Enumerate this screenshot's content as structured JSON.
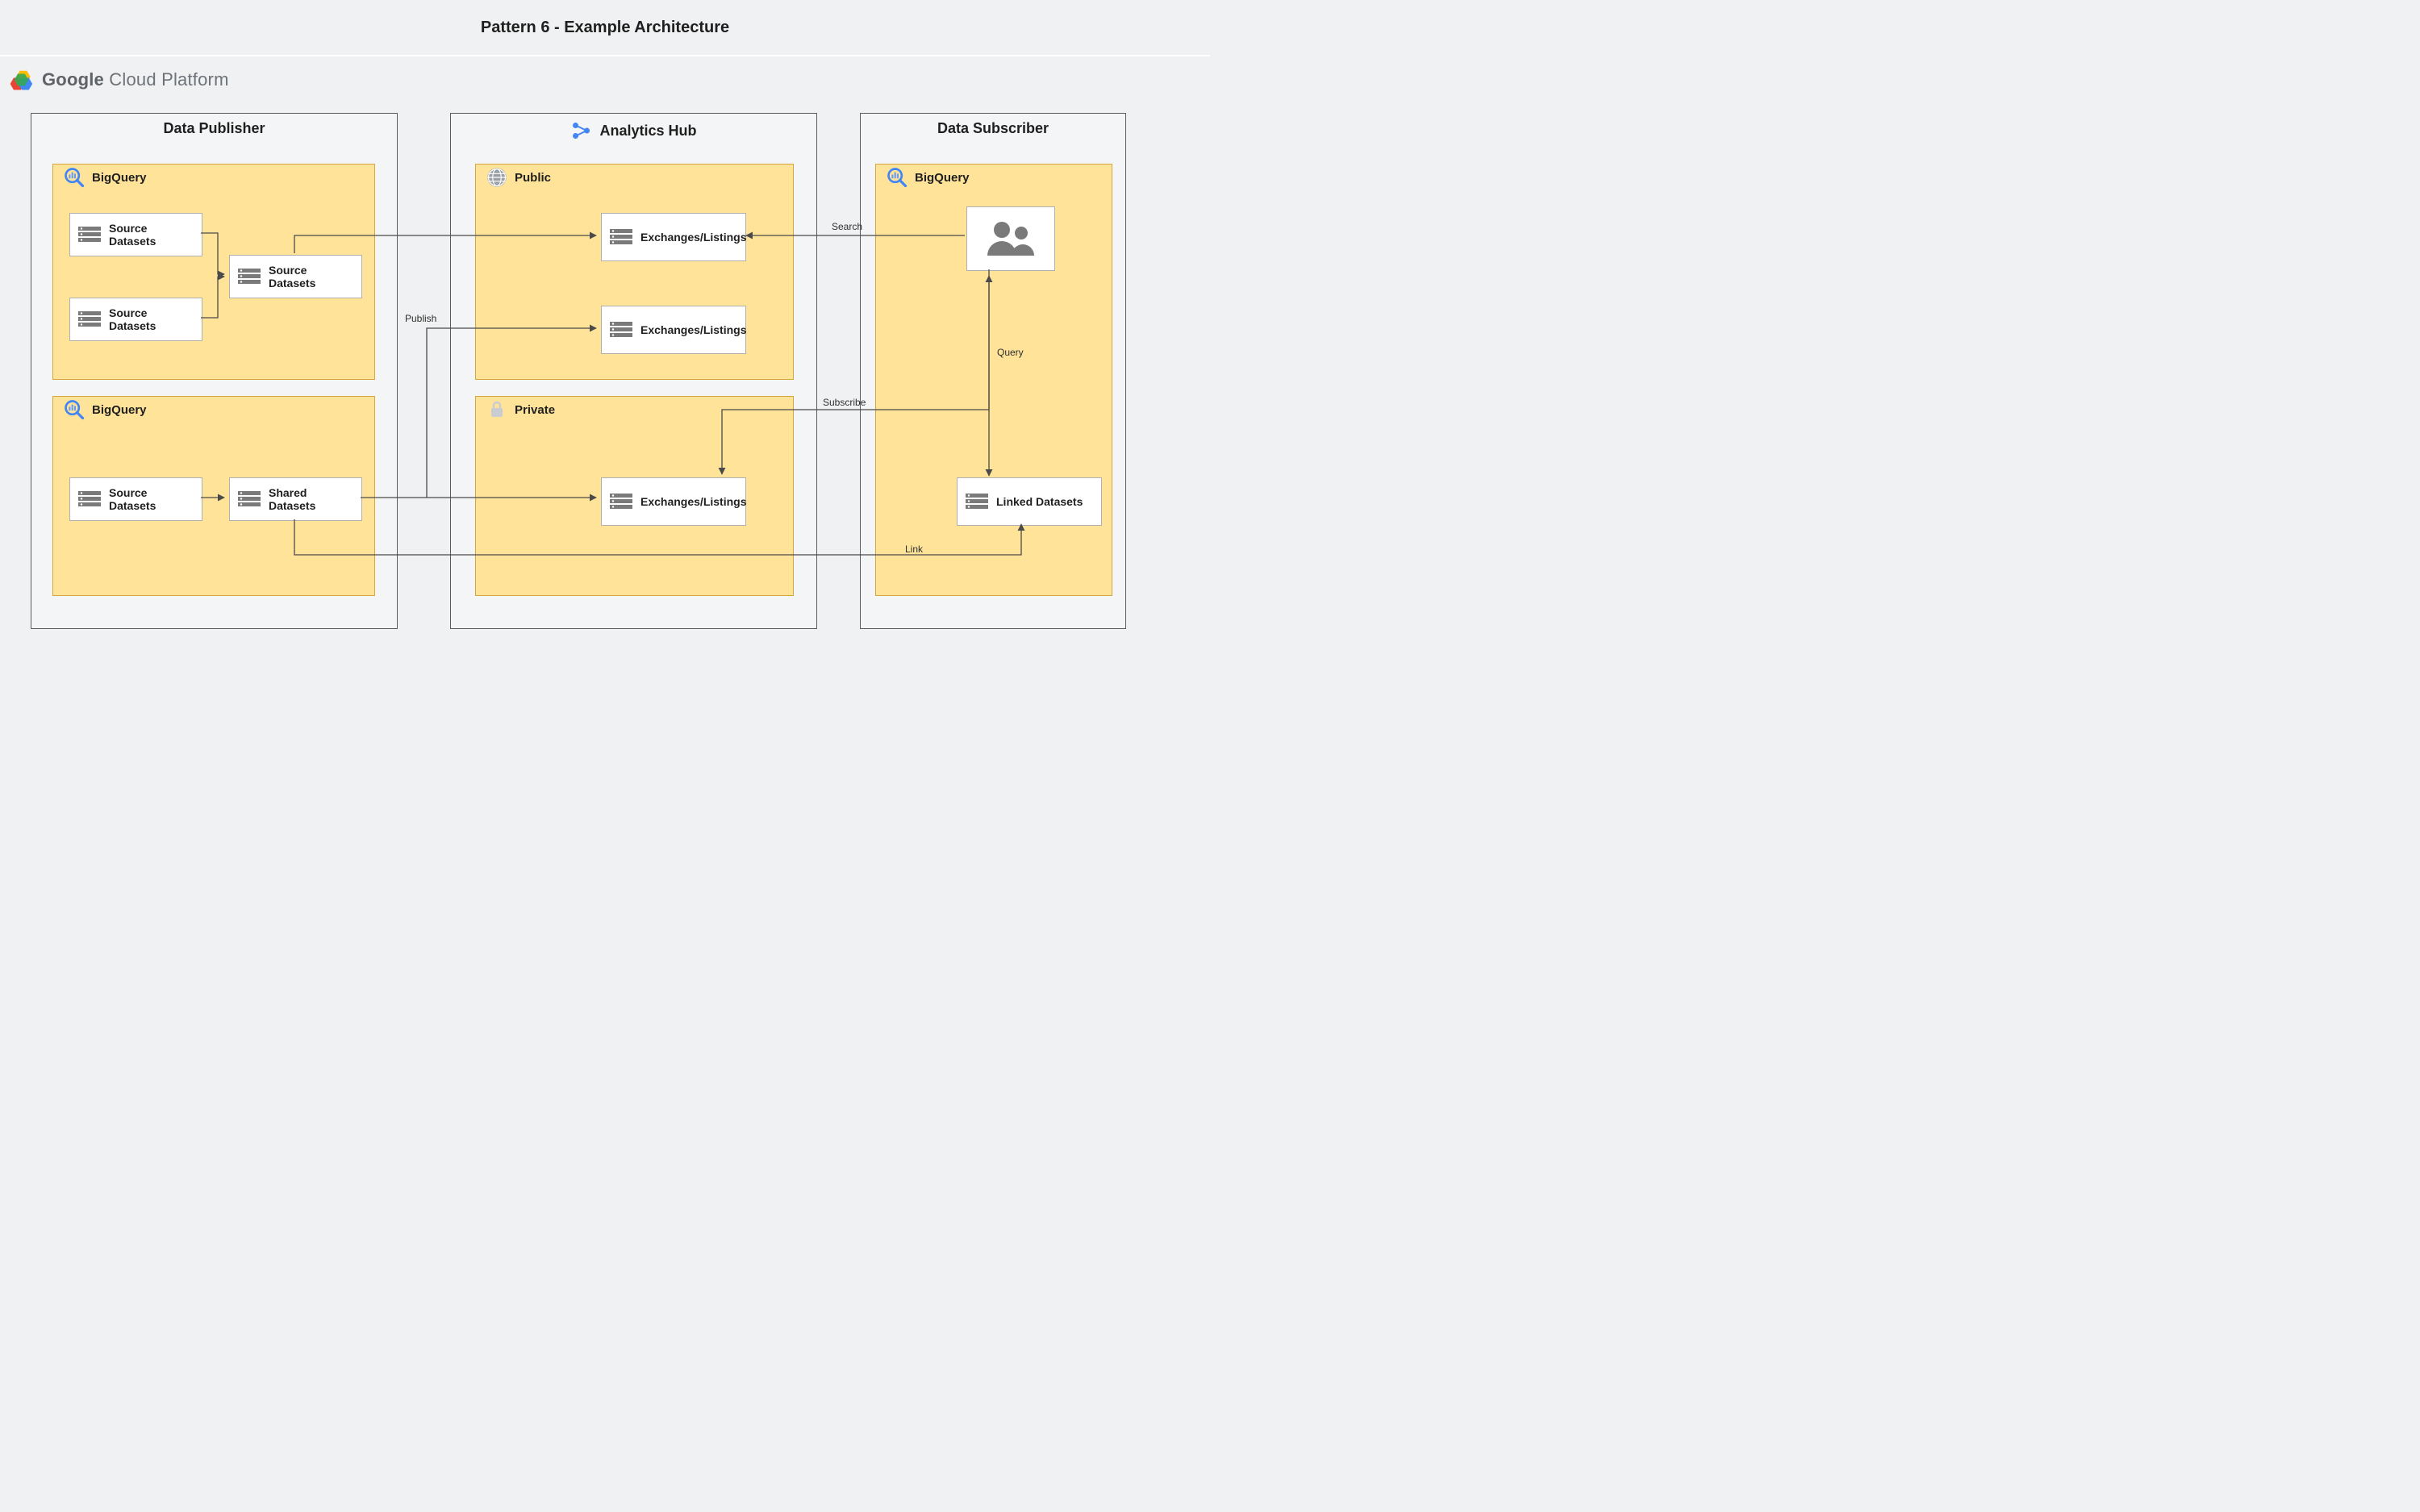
{
  "title": "Pattern 6 - Example Architecture",
  "platform_label_bold": "Google",
  "platform_label_light": " Cloud Platform",
  "columns": {
    "publisher": {
      "title": "Data Publisher"
    },
    "hub": {
      "title": "Analytics Hub"
    },
    "subscriber": {
      "title": "Data Subscriber"
    }
  },
  "publisher": {
    "bq1": {
      "label": "BigQuery",
      "src_a": "Source Datasets",
      "src_b": "Source Datasets",
      "src_merged": "Source Datasets"
    },
    "bq2": {
      "label": "BigQuery",
      "src": "Source Datasets",
      "shared": "Shared Datasets"
    }
  },
  "hub": {
    "public": {
      "label": "Public",
      "listing_top": "Exchanges/Listings",
      "listing_bottom": "Exchanges/Listings"
    },
    "private": {
      "label": "Private",
      "listing": "Exchanges/Listings"
    }
  },
  "subscriber": {
    "bq": {
      "label": "BigQuery",
      "linked": "Linked Datasets"
    }
  },
  "edges": {
    "publish": "Publish",
    "search": "Search",
    "subscribe": "Subscribe",
    "link": "Link",
    "query": "Query"
  }
}
